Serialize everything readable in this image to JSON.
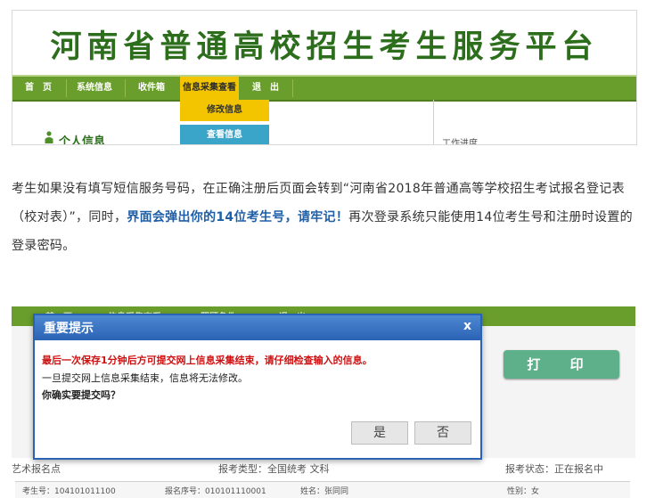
{
  "top_screenshot": {
    "banner_title": "河南省普通高校招生考生服务平台",
    "menu": [
      "首　页",
      "系统信息",
      "收件箱",
      "信息采集查看",
      "退　出"
    ],
    "active_menu": "信息采集查看",
    "dropdown": [
      "修改信息",
      "查看信息"
    ],
    "section_title": "个人信息",
    "right_panel_label": "工作进度"
  },
  "paragraph": {
    "part1": "考生如果没有填写短信服务号码，在正确注册后页面会转到“河南省2018年普通高等学校招生考试报名登记表（校对表）”，同时，",
    "highlight": "界面会弹出你的14位考生号，请牢记！",
    "part2": "再次登录系统只能使用14位考生号和注册时设置的登录密码。"
  },
  "bottom_screenshot": {
    "menu": [
      "首　页",
      "信息采集查看",
      "照顾条件",
      "退　出"
    ],
    "print_button": "打 印",
    "modal": {
      "title": "重要提示",
      "close": "x",
      "warning": "最后一次保存1分钟后方可提交网上信息采集结束，请仔细检查输入的信息。",
      "line2": "一旦提交网上信息采集结束，信息将无法修改。",
      "line3": "你确实要提交吗？",
      "yes": "是",
      "no": "否"
    },
    "info_row": {
      "site": "艺术报名点",
      "type": "报考类型：全国统考 文科",
      "status": "报考状态：正在报名中"
    },
    "table_row": {
      "exam_no": "考生号：104101011100",
      "seq_no": "报名序号：010101110001",
      "name": "姓名：张同同",
      "gender": "性别：女"
    },
    "colors": {
      "menu_green": "#6a9e2c",
      "active_yellow": "#f2c500",
      "modal_blue": "#2a63b4",
      "warning_red": "#d01010",
      "highlight_blue": "#1f5fa8"
    }
  }
}
